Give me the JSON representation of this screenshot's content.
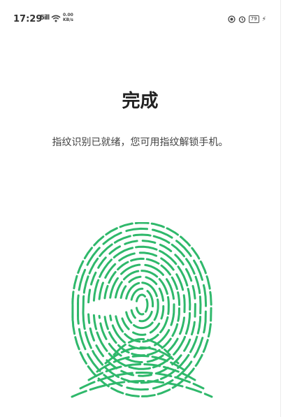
{
  "status_bar": {
    "time": "17:29",
    "signal_label": "5ill",
    "speed_label": "0.00\nKB/s",
    "battery_level": "79",
    "icons": [
      "signal-icon",
      "wifi-icon",
      "data-speed-icon",
      "eye-comfort-icon",
      "alarm-icon",
      "battery-icon",
      "charging-icon"
    ]
  },
  "main": {
    "title": "完成",
    "message": "指纹识别已就绪，您可用指纹解锁手机。"
  },
  "fingerprint": {
    "icon": "fingerprint-icon",
    "color": "#2fb86b"
  }
}
